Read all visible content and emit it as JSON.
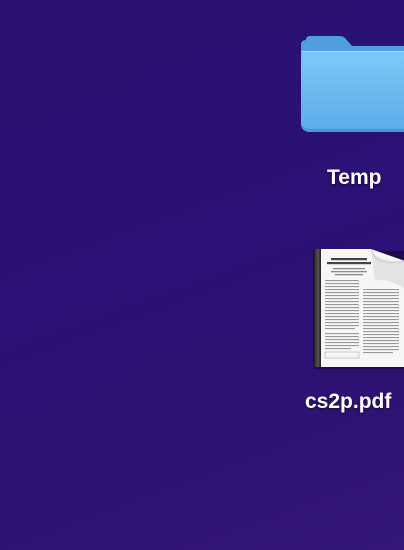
{
  "desktop": {
    "background_color": "#2c1176",
    "items": [
      {
        "label": "Temp",
        "kind": "folder",
        "icon": "folder-icon",
        "color": "#6bbcf2"
      },
      {
        "label": "cs2p.pdf",
        "kind": "file",
        "icon": "pdf-thumbnail-icon"
      }
    ]
  }
}
